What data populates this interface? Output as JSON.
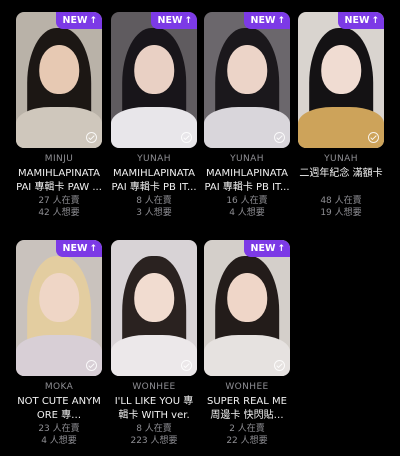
{
  "new_badge": "NEW",
  "cards": [
    {
      "member": "MINJU",
      "title": "MAMIHLAPINATA PAI 專輯卡 PAW ...",
      "selling": "27 人在賣",
      "wanting": "42 人想要",
      "new": true,
      "bg": "#b9b2a8",
      "hair": "#1c1714",
      "skin": "#e7c9b3",
      "cloth": "#cfc7bc"
    },
    {
      "member": "YUNAH",
      "title": "MAMIHLAPINATA PAI 專輯卡 PB IT...",
      "selling": "8 人在賣",
      "wanting": "3 人想要",
      "new": true,
      "bg": "#5f5b5f",
      "hair": "#18151a",
      "skin": "#e9d0c4",
      "cloth": "#e8e6ea"
    },
    {
      "member": "YUNAH",
      "title": "MAMIHLAPINATA PAI 專輯卡 PB IT...",
      "selling": "16 人在賣",
      "wanting": "4 人想要",
      "new": true,
      "bg": "#6b676c",
      "hair": "#1b181c",
      "skin": "#ecd4c8",
      "cloth": "#d9d6db"
    },
    {
      "member": "YUNAH",
      "title": "二週年紀念 滿額卡",
      "selling": "48 人在賣",
      "wanting": "19 人想要",
      "new": true,
      "bg": "#d9d4cf",
      "hair": "#141214",
      "skin": "#f0dcd2",
      "cloth": "#cda35a"
    },
    {
      "member": "MOKA",
      "title": "NOT CUTE ANYMORE 專…",
      "selling": "23 人在賣",
      "wanting": "4 人想要",
      "new": true,
      "bg": "#c9c2bd",
      "hair": "#e3cda0",
      "skin": "#efd6c6",
      "cloth": "#d8cfd6"
    },
    {
      "member": "WONHEE",
      "title": "I'LL LIKE YOU 專輯卡 WITH ver.",
      "selling": "8 人在賣",
      "wanting": "223 人想要",
      "new": false,
      "bg": "#d8d3d6",
      "hair": "#2a2220",
      "skin": "#f1dcd0",
      "cloth": "#ece8ea"
    },
    {
      "member": "WONHEE",
      "title": "SUPER REAL ME 周邊卡 快閃貼…",
      "selling": "2 人在賣",
      "wanting": "22 人想要",
      "new": true,
      "bg": "#d4cfca",
      "hair": "#231c1a",
      "skin": "#efd6c8",
      "cloth": "#e6e2e0"
    }
  ]
}
